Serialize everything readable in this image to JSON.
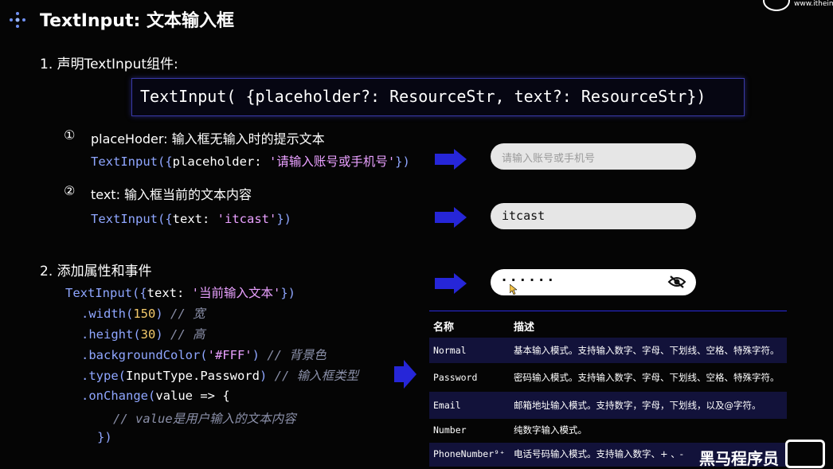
{
  "title": "TextInput: 文本输入框",
  "watermark_top": "www.itheim",
  "section1": {
    "heading": "1. 声明TextInput组件:",
    "signature": "TextInput( {placeholder?: ResourceStr, text?: ResourceStr})",
    "item1_num": "①",
    "item1_text": "placeHoder: 输入框无输入时的提示文本",
    "item1_code_a": "TextInput({",
    "item1_code_b": "placeholder: ",
    "item1_code_c": "'请输入账号或手机号'",
    "item1_code_d": "})",
    "item2_num": "②",
    "item2_text": "text: 输入框当前的文本内容",
    "item2_code_a": "TextInput({",
    "item2_code_b": "text: ",
    "item2_code_c": "'itcast'",
    "item2_code_d": "})"
  },
  "preview": {
    "placeholder": "请输入账号或手机号",
    "text_value": "itcast",
    "password_dots": "· · · · · ·"
  },
  "section2": {
    "heading": "2. 添加属性和事件",
    "l1a": "TextInput({",
    "l1b": "text: ",
    "l1c": "'当前输入文本'",
    "l1d": "})",
    "l2a": ".width(",
    "l2b": "150",
    "l2c": ") ",
    "l2d": "// 宽",
    "l3a": ".height(",
    "l3b": "30",
    "l3c": ") ",
    "l3d": "// 高",
    "l4a": ".backgroundColor(",
    "l4b": "'#FFF'",
    "l4c": ") ",
    "l4d": "// 背景色",
    "l5a": ".type(",
    "l5b": "InputType.Password",
    "l5c": ") ",
    "l5d": "// 输入框类型",
    "l6a": ".onChange(",
    "l6b": "value => {",
    "l7": "// value是用户输入的文本内容",
    "l8": "})"
  },
  "table": {
    "headers": [
      "名称",
      "描述"
    ],
    "rows": [
      [
        "Normal",
        "基本输入模式。支持输入数字、字母、下划线、空格、特殊字符。"
      ],
      [
        "Password",
        "密码输入模式。支持输入数字、字母、下划线、空格、特殊字符。"
      ],
      [
        "Email",
        "邮箱地址输入模式。支持数字，字母，下划线，以及@字符。"
      ],
      [
        "Number",
        "纯数字输入模式。"
      ],
      [
        "PhoneNumber⁹⁺",
        "电话号码输入模式。支持输入数字、+ 、-"
      ]
    ]
  },
  "watermark": "黑马程序员",
  "colors": {
    "accent": "#2a2ae0",
    "code_blue": "#8fa6ff",
    "string": "#e9a0ff"
  }
}
